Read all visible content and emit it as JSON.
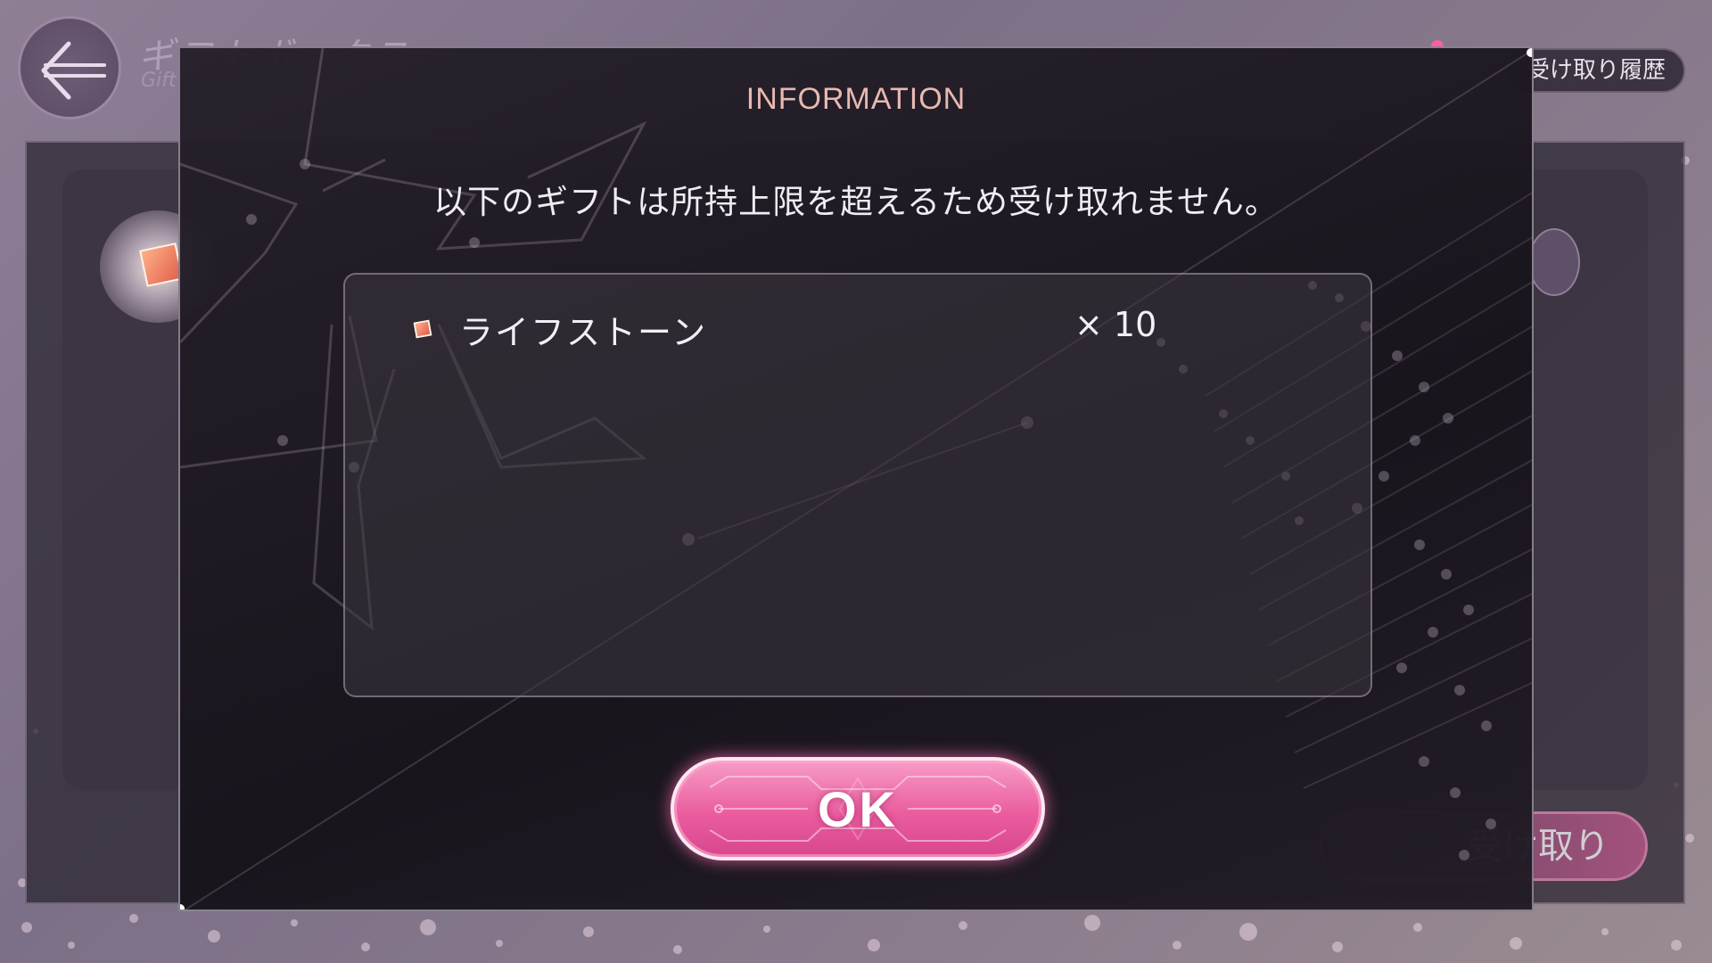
{
  "background": {
    "page_title": "ギフトボックス",
    "page_subtitle": "Gift",
    "history_button": "受け取り履歴",
    "receive_button": "受け取り"
  },
  "dialog": {
    "title": "INFORMATION",
    "message": "以下のギフトは所持上限を超えるため受け取れません。",
    "items": [
      {
        "icon": "life-stone-icon",
        "name": "ライフストーン",
        "quantity": "× 10"
      }
    ],
    "ok_label": "OK"
  },
  "colors": {
    "accent_pink": "#ea5d9f",
    "title_color": "#e7b9b1"
  }
}
